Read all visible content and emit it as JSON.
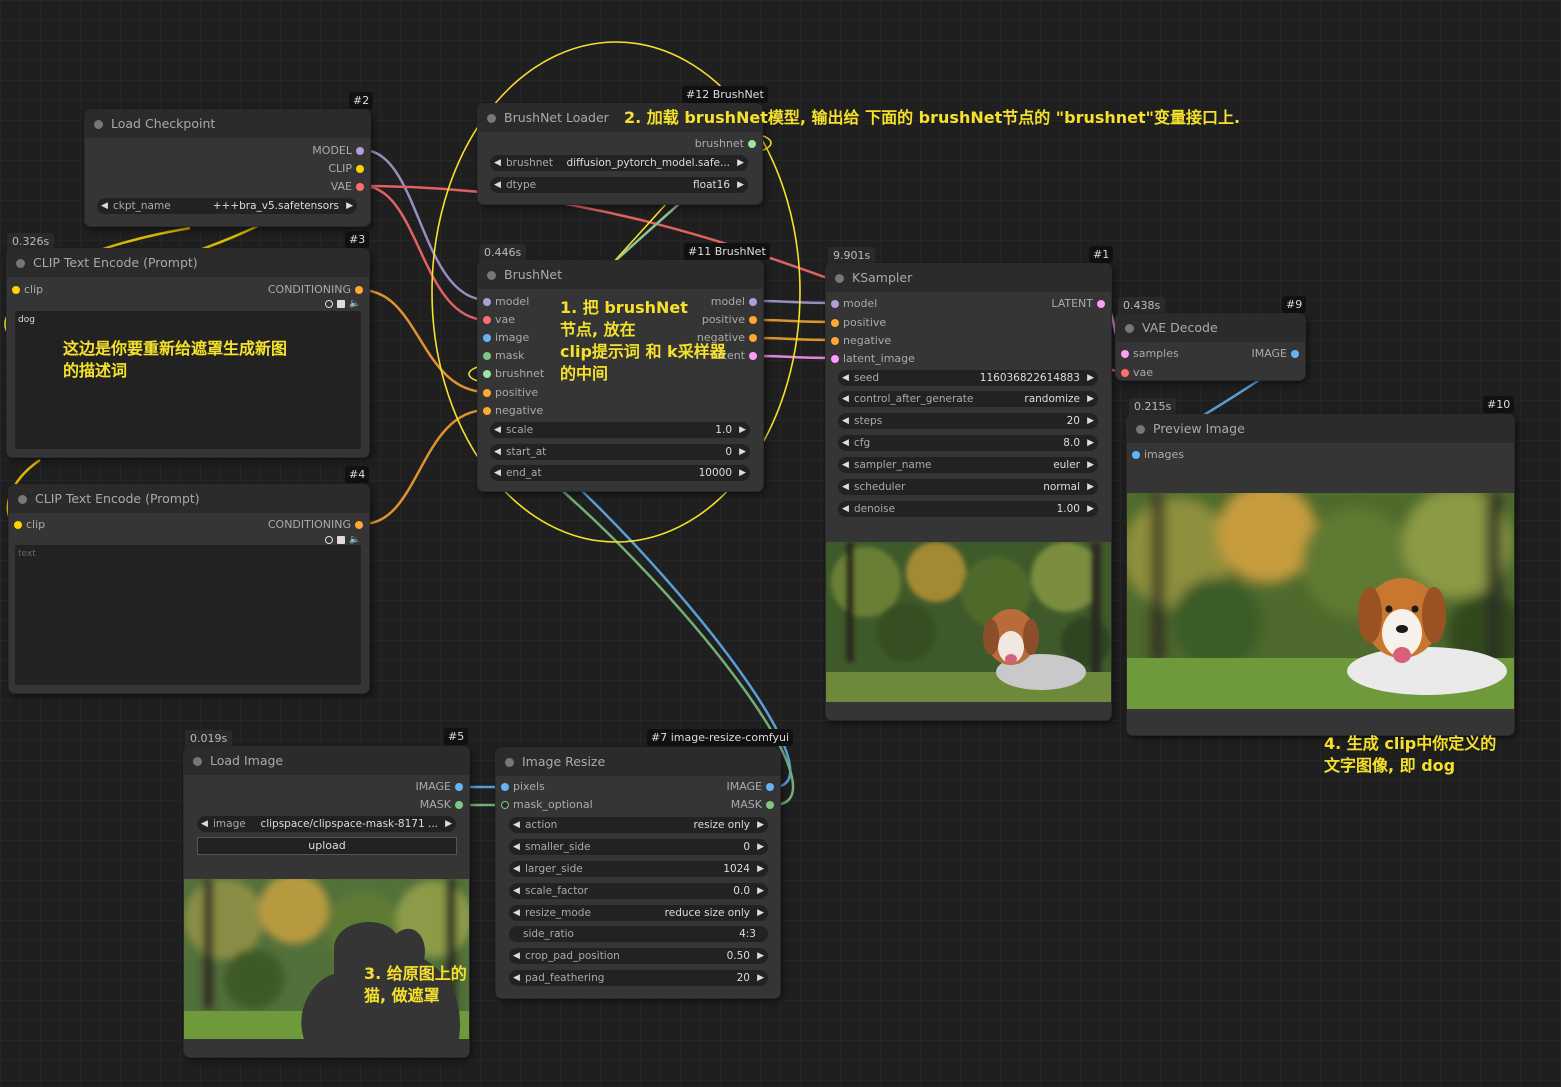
{
  "colors": {
    "model": "#b39ddb",
    "clip": "#ffd500",
    "vae": "#ff6e6e",
    "conditioning": "#ffa931",
    "latent": "#ff9cf9",
    "image": "#64b5f6",
    "mask": "#81c784",
    "brushnet": "#9fe2a6",
    "annotation": "#f5e12c"
  },
  "nodes": {
    "load_checkpoint": {
      "id": "#2",
      "title": "Load Checkpoint",
      "outputs": [
        "MODEL",
        "CLIP",
        "VAE"
      ],
      "ckpt_label": "ckpt_name",
      "ckpt_value": "+++bra_v5.safetensors"
    },
    "clip_text_1": {
      "id": "#3",
      "time": "0.326s",
      "title": "CLIP Text Encode (Prompt)",
      "input": "clip",
      "output": "CONDITIONING",
      "text": "dog"
    },
    "clip_text_2": {
      "id": "#4",
      "title": "CLIP Text Encode (Prompt)",
      "input": "clip",
      "output": "CONDITIONING",
      "placeholder": "text"
    },
    "brushnet_loader": {
      "id": "#12 BrushNet",
      "title": "BrushNet Loader",
      "output": "brushnet",
      "w1_label": "brushnet",
      "w1_value": "diffusion_pytorch_model.safe...",
      "w2_label": "dtype",
      "w2_value": "float16"
    },
    "brushnet": {
      "id": "#11 BrushNet",
      "time": "0.446s",
      "title": "BrushNet",
      "inputs": [
        "model",
        "vae",
        "image",
        "mask",
        "brushnet",
        "positive",
        "negative"
      ],
      "outputs": [
        "model",
        "positive",
        "negative",
        "latent"
      ],
      "widgets": [
        {
          "label": "scale",
          "value": "1.0"
        },
        {
          "label": "start_at",
          "value": "0"
        },
        {
          "label": "end_at",
          "value": "10000"
        }
      ]
    },
    "ksampler": {
      "id": "#1",
      "time": "9.901s",
      "title": "KSampler",
      "inputs": [
        "model",
        "positive",
        "negative",
        "latent_image"
      ],
      "output": "LATENT",
      "widgets": [
        {
          "label": "seed",
          "value": "116036822614883"
        },
        {
          "label": "control_after_generate",
          "value": "randomize"
        },
        {
          "label": "steps",
          "value": "20"
        },
        {
          "label": "cfg",
          "value": "8.0"
        },
        {
          "label": "sampler_name",
          "value": "euler"
        },
        {
          "label": "scheduler",
          "value": "normal"
        },
        {
          "label": "denoise",
          "value": "1.00"
        }
      ]
    },
    "vae_decode": {
      "id": "#9",
      "time": "0.438s",
      "title": "VAE Decode",
      "inputs": [
        "samples",
        "vae"
      ],
      "output": "IMAGE"
    },
    "preview_image": {
      "id": "#10",
      "time": "0.215s",
      "title": "Preview Image",
      "input": "images"
    },
    "load_image": {
      "id": "#5",
      "time": "0.019s",
      "title": "Load Image",
      "outputs": [
        "IMAGE",
        "MASK"
      ],
      "image_label": "image",
      "image_value": "clipspace/clipspace-mask-8171 ...",
      "upload_label": "upload"
    },
    "image_resize": {
      "id": "#7 image-resize-comfyui",
      "title": "Image Resize",
      "inputs": [
        "pixels",
        "mask_optional"
      ],
      "outputs": [
        "IMAGE",
        "MASK"
      ],
      "widgets": [
        {
          "label": "action",
          "value": "resize only"
        },
        {
          "label": "smaller_side",
          "value": "0"
        },
        {
          "label": "larger_side",
          "value": "1024"
        },
        {
          "label": "scale_factor",
          "value": "0.0"
        },
        {
          "label": "resize_mode",
          "value": "reduce size only"
        },
        {
          "label": "side_ratio",
          "value": "4:3"
        },
        {
          "label": "crop_pad_position",
          "value": "0.50"
        },
        {
          "label": "pad_feathering",
          "value": "20"
        }
      ]
    }
  },
  "annotations": {
    "a1": "1. 把 brushNet\n节点, 放在\nclip提示词 和 k采样器\n的中间",
    "a2": "2. 加载 brushNet模型, 输出给 下面的 brushNet节点的 \"brushnet\"变量接口上.",
    "a3": "3. 给原图上的\n猫, 做遮罩",
    "a4": "4. 生成 clip中你定义的\n文字图像, 即 dog",
    "a_left": "这边是你要重新给遮罩生成新图\n的描述词"
  }
}
